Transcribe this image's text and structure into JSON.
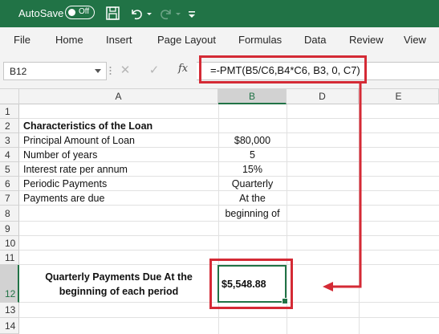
{
  "titlebar": {
    "autosave_label": "AutoSave",
    "toggle_state": "Off"
  },
  "ribbon_tabs": [
    "File",
    "Home",
    "Insert",
    "Page Layout",
    "Formulas",
    "Data",
    "Review",
    "View"
  ],
  "formula_bar": {
    "name_box": "B12",
    "fx": "fx",
    "formula": "=-PMT(B5/C6,B4*C6, B3, 0, C7)"
  },
  "columns": [
    "A",
    "B",
    "D",
    "E"
  ],
  "rows": [
    "1",
    "2",
    "3",
    "4",
    "5",
    "6",
    "7",
    "8",
    "9",
    "10",
    "11",
    "12",
    "13",
    "14"
  ],
  "cells": {
    "a2": "Characteristics of the Loan",
    "a3": "Principal Amount of Loan",
    "b3": "$80,000",
    "a4": "Number of years",
    "b4": "5",
    "a5": "Interest rate per annum",
    "b5": "15%",
    "a6": "Periodic Payments",
    "b6": "Quarterly",
    "a7": "Payments are due",
    "b7": "At the",
    "b8": "beginning of",
    "a12_line1": "Quarterly Payments Due At the",
    "a12_line2": "beginning of each period",
    "b12": "$5,548.88"
  },
  "colors": {
    "excel_green": "#217346",
    "highlight_red": "#d42a35"
  }
}
